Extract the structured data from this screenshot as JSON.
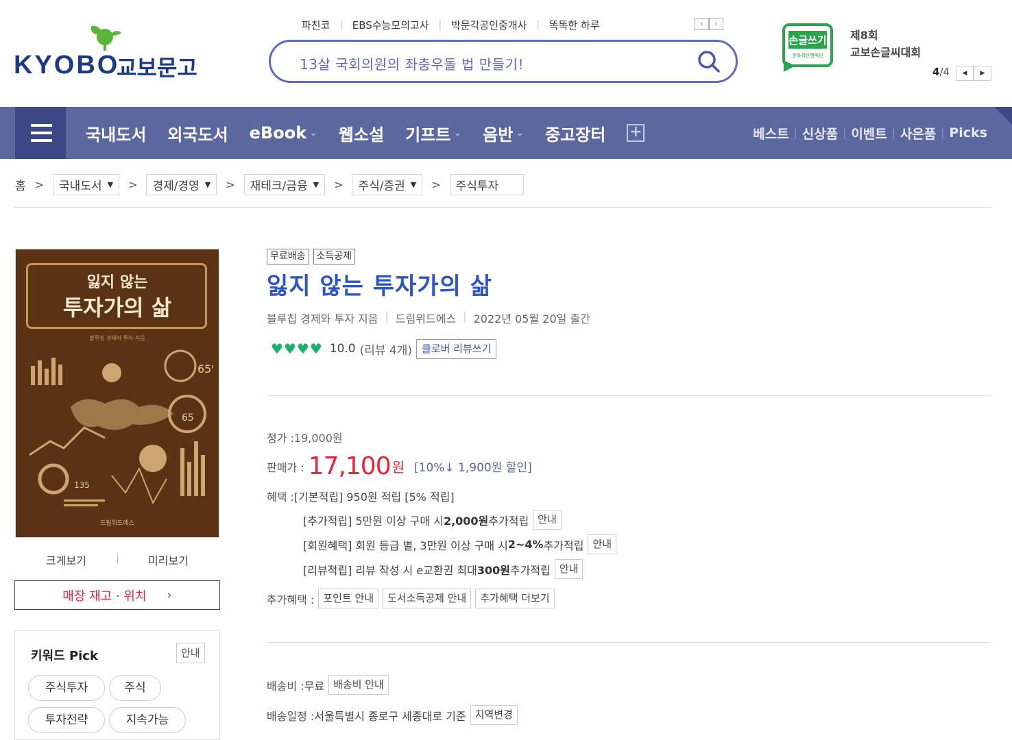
{
  "header": {
    "logo_en": "KYOBO",
    "logo_ko": "교보문고",
    "top_links": [
      "파친코",
      "EBS수능모의고사",
      "박문각공인중개사",
      "똑똑한 하루"
    ],
    "search_text": "13살 국회의원의 좌충우돌 법 만들기!",
    "banner": {
      "badge": "손글쓰기",
      "badge_sub": "문화확산캠페인",
      "line1": "제8회",
      "line2": "교보손글씨대회",
      "page_current": "4",
      "page_total": "/4"
    }
  },
  "nav": {
    "items": [
      {
        "label": "국내도서",
        "dropdown": false
      },
      {
        "label": "외국도서",
        "dropdown": false
      },
      {
        "label": "eBook",
        "dropdown": true
      },
      {
        "label": "웹소설",
        "dropdown": false
      },
      {
        "label": "기프트",
        "dropdown": true
      },
      {
        "label": "음반",
        "dropdown": true
      },
      {
        "label": "중고장터",
        "dropdown": false
      }
    ],
    "right": [
      "베스트",
      "신상품",
      "이벤트",
      "사은품",
      "Picks"
    ]
  },
  "breadcrumb": {
    "home": "홈",
    "levels": [
      "국내도서",
      "경제/경영",
      "재테크/금융",
      "주식/증권",
      "주식투자"
    ]
  },
  "cover": {
    "title1": "잃지 않는",
    "title2": "투자가의 삶",
    "subtitle": "블루칩 경제와 투자 지음",
    "publisher": "드림위드에스"
  },
  "left": {
    "zoom": "크게보기",
    "preview": "미리보기",
    "stock": "매장 재고 · 위치",
    "keyword_title": "키워드 Pick",
    "keyword_info": "안내",
    "tags": [
      "주식투자",
      "주식",
      "투자전략",
      "지속가능"
    ]
  },
  "product": {
    "badges": [
      "무료배송",
      "소득공제"
    ],
    "title": "잃지 않는 투자가의 삶",
    "author": "블루칩 경제와 투자 지음",
    "publisher": "드림위드에스",
    "date": "2022년 05월 20일 출간",
    "hearts": 4,
    "score": "10.0",
    "reviews": "(리뷰 4개)",
    "review_button": "클로버 리뷰쓰기"
  },
  "price": {
    "list_label": "정가 : ",
    "list_value": "19,000원",
    "sale_label": "판매가 : ",
    "sale_value": "17,100",
    "sale_unit": "원",
    "discount": "[10%↓ 1,900원 할인]",
    "benefit_label": "혜택 : ",
    "benefit_basic": "[기본적립] 950원 적립 [5% 적립]",
    "extra1_pre": "[추가적립] 5만원 이상 구매 시 ",
    "extra1_bold": "2,000원",
    "extra1_post": " 추가적립",
    "extra2_pre": "[회원혜택] 회원 등급 별, 3만원 이상 구매 시 ",
    "extra2_bold": "2~4%",
    "extra2_post": " 추가적립",
    "extra3_pre": "[리뷰적립] 리뷰 작성 시 e교환권 최대 ",
    "extra3_bold": "300원",
    "extra3_post": " 추가적립",
    "info_btn": "안내",
    "more_label": "추가혜택 : ",
    "more_btns": [
      "포인트 안내",
      "도서소득공제 안내",
      "추가혜택 더보기"
    ]
  },
  "shipping": {
    "fee_label": "배송비 : ",
    "fee_value": "무료",
    "fee_btn": "배송비 안내",
    "schedule_label": "배송일정 : ",
    "schedule_value": "서울특별시 종로구 세종대로 기준",
    "schedule_btn": "지역변경"
  },
  "colors": {
    "brand": "#1d3a85",
    "nav": "#5b679f",
    "title": "#2e55c6",
    "price": "#e8233c",
    "heart": "#1fae6a"
  }
}
